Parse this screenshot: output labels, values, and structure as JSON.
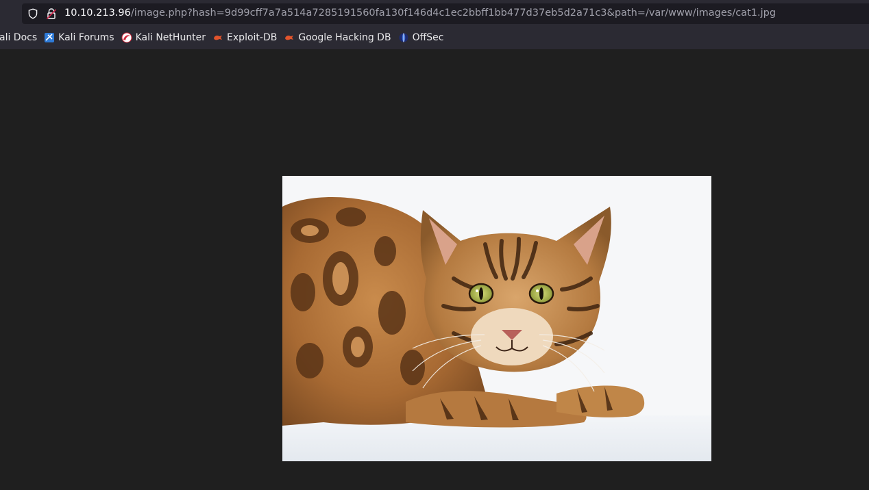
{
  "browser": {
    "url_host": "10.10.213.96",
    "url_rest": "/image.php?hash=9d99cff7a7a514a7285191560fa130f146d4c1ec2bbff1bb477d37eb5d2a71c3&path=/var/www/images/cat1.jpg"
  },
  "bookmarks": [
    {
      "label": "ali Docs",
      "icon": "kali-docs-icon"
    },
    {
      "label": "Kali Forums",
      "icon": "kali-forums-icon"
    },
    {
      "label": "Kali NetHunter",
      "icon": "kali-nethunter-icon"
    },
    {
      "label": "Exploit-DB",
      "icon": "exploit-db-icon"
    },
    {
      "label": "Google Hacking DB",
      "icon": "google-hacking-db-icon"
    },
    {
      "label": "OffSec",
      "icon": "offsec-icon"
    }
  ],
  "page": {
    "image_alt": "cat1.jpg",
    "image_subject": "bengal-cat-photo"
  },
  "colors": {
    "toolbar_bg": "#2b2a33",
    "urlbar_bg": "#1c1b22",
    "page_bg": "#1f1f1f",
    "exploit_orange": "#e2542c",
    "offsec_blue": "#3b6fd8"
  }
}
